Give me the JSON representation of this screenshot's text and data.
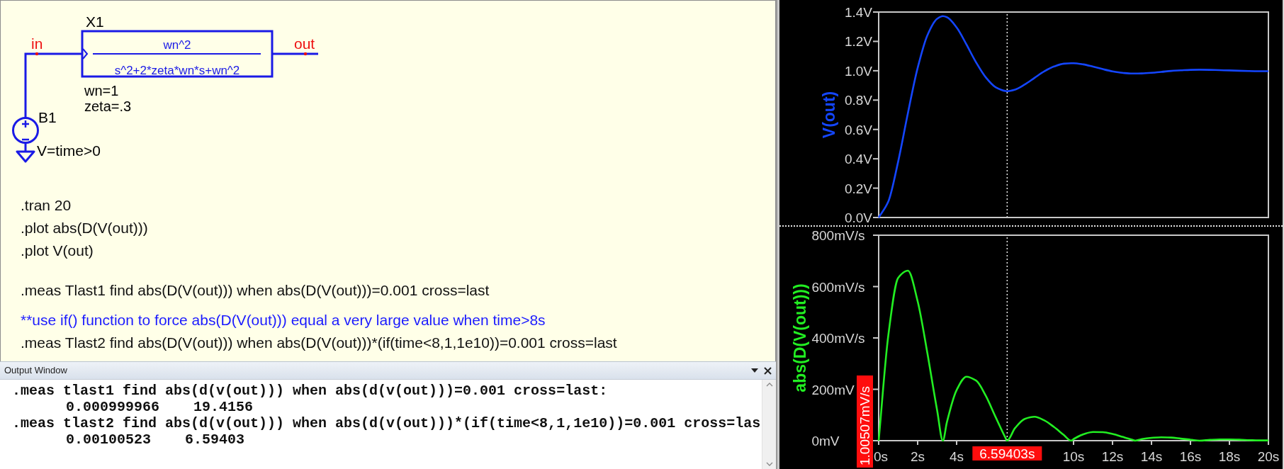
{
  "schematic": {
    "block": {
      "ref": "X1",
      "numerator": "wn^2",
      "denominator": "s^2+2*zeta*wn*s+wn^2",
      "params": [
        "wn=1",
        "zeta=.3"
      ]
    },
    "source": {
      "ref": "B1",
      "value": "V=time>0"
    },
    "nets": [
      {
        "label": "in"
      },
      {
        "label": "out"
      }
    ],
    "directive_groups": [
      {
        "lines": [
          {
            "kind": "command",
            "text": ".tran 20"
          },
          {
            "kind": "command",
            "text": ".plot abs(D(V(out)))"
          },
          {
            "kind": "command",
            "text": ".plot V(out)"
          }
        ]
      },
      {
        "lines": [
          {
            "kind": "command",
            "text": ".meas Tlast1 find abs(D(V(out))) when abs(D(V(out)))=0.001 cross=last"
          }
        ]
      },
      {
        "lines": [
          {
            "kind": "comment",
            "text": "**use if() function to force abs(D(V(out))) equal a very large value when time>8s"
          },
          {
            "kind": "command",
            "text": ".meas Tlast2 find abs(D(V(out))) when abs(D(V(out)))*(if(time<8,1,1e10))=0.001 cross=last"
          }
        ]
      }
    ]
  },
  "output_window": {
    "title": "Output Window",
    "lines": [
      {
        "kind": "statement",
        "text": ".meas tlast1 find abs(d(v(out))) when abs(d(v(out)))=0.001 cross=last:"
      },
      {
        "kind": "result",
        "text": "0.000999966    19.4156"
      },
      {
        "kind": "statement",
        "text": ".meas tlast2 find abs(d(v(out))) when abs(d(v(out)))*(if(time<8,1,1e10))=0.001 cross=las"
      },
      {
        "kind": "result",
        "text": "0.00100523    6.59403"
      }
    ]
  },
  "plots": [
    {
      "chart_data": {
        "type": "line",
        "x": [
          0,
          0.5,
          1,
          1.5,
          2,
          2.5,
          3,
          3.293,
          3.5,
          4,
          4.5,
          5,
          5.5,
          6,
          6.5,
          6.586,
          7,
          7.5,
          8,
          8.5,
          9,
          9.5,
          9.879,
          10,
          10.5,
          11,
          11.5,
          12,
          12.5,
          13,
          13.172,
          13.5,
          14,
          14.5,
          15,
          15.5,
          16,
          16.466,
          17,
          17.5,
          18,
          18.5,
          19,
          19.5,
          20
        ],
        "series": [
          {
            "name": "V(out)",
            "color": "#1446ff",
            "values": [
              0,
              0.111,
              0.381,
              0.712,
              1.019,
              1.242,
              1.354,
              1.372,
              1.365,
              1.295,
              1.18,
              1.057,
              0.954,
              0.888,
              0.862,
              0.861,
              0.872,
              0.907,
              0.952,
              0.996,
              1.029,
              1.048,
              1.051,
              1.051,
              1.043,
              1.028,
              1.011,
              0.996,
              0.986,
              0.981,
              0.981,
              0.982,
              0.986,
              0.992,
              0.999,
              1.003,
              1.006,
              1.007,
              1.006,
              1.004,
              1.002,
              1.0,
              0.998,
              0.997,
              0.997
            ]
          }
        ],
        "xlim": [
          0,
          20
        ],
        "ylim": [
          0,
          1.4
        ],
        "yticks": [
          {
            "value": 0,
            "label": "0.0V"
          },
          {
            "value": 0.2,
            "label": "0.2V"
          },
          {
            "value": 0.4,
            "label": "0.4V"
          },
          {
            "value": 0.6,
            "label": "0.6V"
          },
          {
            "value": 0.8,
            "label": "0.8V"
          },
          {
            "value": 1.0,
            "label": "1.0V"
          },
          {
            "value": 1.2,
            "label": "1.2V"
          },
          {
            "value": 1.4,
            "label": "1.4V"
          }
        ],
        "ref_lines": [
          {
            "axis": "x",
            "value": 6.59403
          }
        ]
      }
    },
    {
      "chart_data": {
        "type": "line",
        "x": [
          0,
          0.5,
          1,
          1.5,
          2,
          2.5,
          3,
          3.293,
          3.5,
          4,
          4.5,
          5,
          5.5,
          6,
          6.5,
          6.586,
          7,
          7.5,
          8,
          8.5,
          9,
          9.5,
          9.879,
          10,
          10.5,
          11,
          11.5,
          12,
          12.5,
          13,
          13.172,
          13.5,
          14,
          14.5,
          15,
          15.5,
          16,
          16.466,
          17,
          17.5,
          18,
          18.5,
          19,
          19.5,
          20
        ],
        "series": [
          {
            "name": "abs(D(V(out)))",
            "color": "#22ee22",
            "values": [
              0,
              414,
              634,
              662,
              543,
              340,
              118,
              0,
              72,
              197,
              249,
              234,
              174,
              92,
              12,
              0,
              49,
              85,
              93,
              79,
              53,
              22,
              0,
              6,
              25,
              34,
              33,
              26,
              15,
              4,
              0,
              6,
              11,
              13,
              12,
              8,
              4,
              0,
              3,
              5,
              5,
              4,
              2,
              1,
              1
            ]
          }
        ],
        "xlim": [
          0,
          20
        ],
        "ylim": [
          0,
          800
        ],
        "xticks": [
          {
            "value": 0,
            "label": "0s"
          },
          {
            "value": 2,
            "label": "2s"
          },
          {
            "value": 4,
            "label": "4s"
          },
          {
            "value": 10,
            "label": "10s"
          },
          {
            "value": 12,
            "label": "12s"
          },
          {
            "value": 14,
            "label": "14s"
          },
          {
            "value": 16,
            "label": "16s"
          },
          {
            "value": 18,
            "label": "18s"
          },
          {
            "value": 20,
            "label": "20s"
          }
        ],
        "yticks": [
          {
            "value": 0,
            "label": "0mV"
          },
          {
            "value": 200,
            "label": "200mV"
          },
          {
            "value": 400,
            "label": "400mV/s"
          },
          {
            "value": 600,
            "label": "600mV/s"
          },
          {
            "value": 800,
            "label": "800mV/s"
          }
        ],
        "ref_lines": [
          {
            "axis": "x",
            "value": 6.59403,
            "label": "6.59403s"
          }
        ]
      },
      "cursor_readouts": {
        "y": "1.00507mV/s"
      }
    }
  ]
}
